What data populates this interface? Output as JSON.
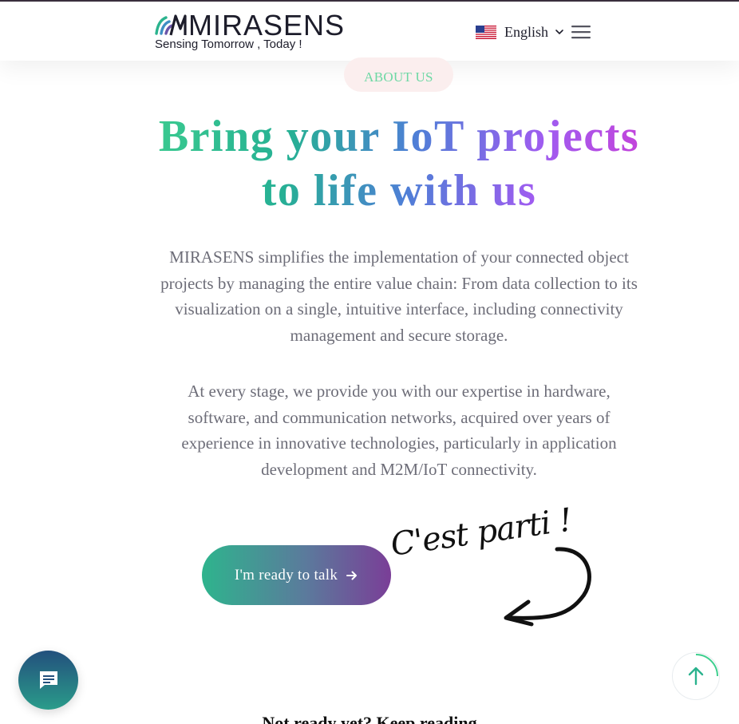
{
  "header": {
    "logo_text": "MIRASENS",
    "tagline": "Sensing Tomorrow , Today !",
    "language": "English",
    "menu_icon": "hamburger-menu-icon",
    "flag_icon": "us-flag-icon"
  },
  "about": {
    "badge": "ABOUT US",
    "title_line1": "Bring your IoT projects",
    "title_line2": "to life with us",
    "paragraph1": "MIRASENS simplifies the implementation of your connected object projects by managing the entire value chain: From data collection to its visualization on a single, intuitive interface, including connectivity management and secure storage.",
    "paragraph2": "At every stage, we provide you with our expertise in hardware, software, and communication networks, acquired over years of experience in innovative technologies, particularly in application development and M2M/IoT connectivity."
  },
  "cta": {
    "label": "I'm ready to talk",
    "arrow_icon": "arrow-right-icon",
    "script_text": "C'est parti !"
  },
  "floating": {
    "chat_icon": "chat-bubble-icon",
    "scroll_top_icon": "arrow-up-icon"
  },
  "teaser": "Not ready yet? Keep reading",
  "colors": {
    "gradient_start": "#3ecf8e",
    "gradient_mid": "#4e7fd6",
    "gradient_end": "#d33ad2",
    "badge_text": "#6dd8a4",
    "badge_bg": "#fbeeee",
    "cta_start": "#2eb48d",
    "cta_end": "#7a3e97"
  }
}
